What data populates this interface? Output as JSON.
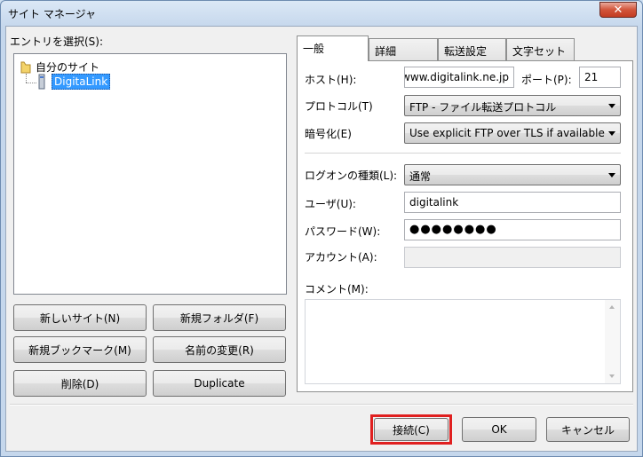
{
  "window": {
    "title": "サイト マネージャ",
    "close_glyph": "✕"
  },
  "left": {
    "select_label": "エントリを選択(S):",
    "tree": {
      "root_label": "自分のサイト",
      "child_label": "DigitaLink"
    },
    "buttons": {
      "new_site": "新しいサイト(N)",
      "new_folder": "新規フォルダ(F)",
      "new_bookmark": "新規ブックマーク(M)",
      "rename": "名前の変更(R)",
      "delete": "削除(D)",
      "duplicate": "Duplicate"
    }
  },
  "tabs": [
    "一般",
    "詳細",
    "転送設定",
    "文字セット"
  ],
  "general": {
    "host_label": "ホスト(H):",
    "host_value": "www.digitalink.ne.jp",
    "port_label": "ポート(P):",
    "port_value": "21",
    "protocol_label": "プロトコル(T)",
    "protocol_value": "FTP - ファイル転送プロトコル",
    "encryption_label": "暗号化(E)",
    "encryption_value": "Use explicit FTP over TLS if available",
    "logon_label": "ログオンの種類(L):",
    "logon_value": "通常",
    "user_label": "ユーザ(U):",
    "user_value": "digitalink",
    "password_label": "パスワード(W):",
    "password_value": "●●●●●●●●",
    "account_label": "アカウント(A):",
    "account_value": "",
    "comment_label": "コメント(M):",
    "comment_value": ""
  },
  "footer": {
    "connect": "接続(C)",
    "ok": "OK",
    "cancel": "キャンセル"
  },
  "colors": {
    "highlight": "#e02020",
    "selection": "#3399ff"
  }
}
